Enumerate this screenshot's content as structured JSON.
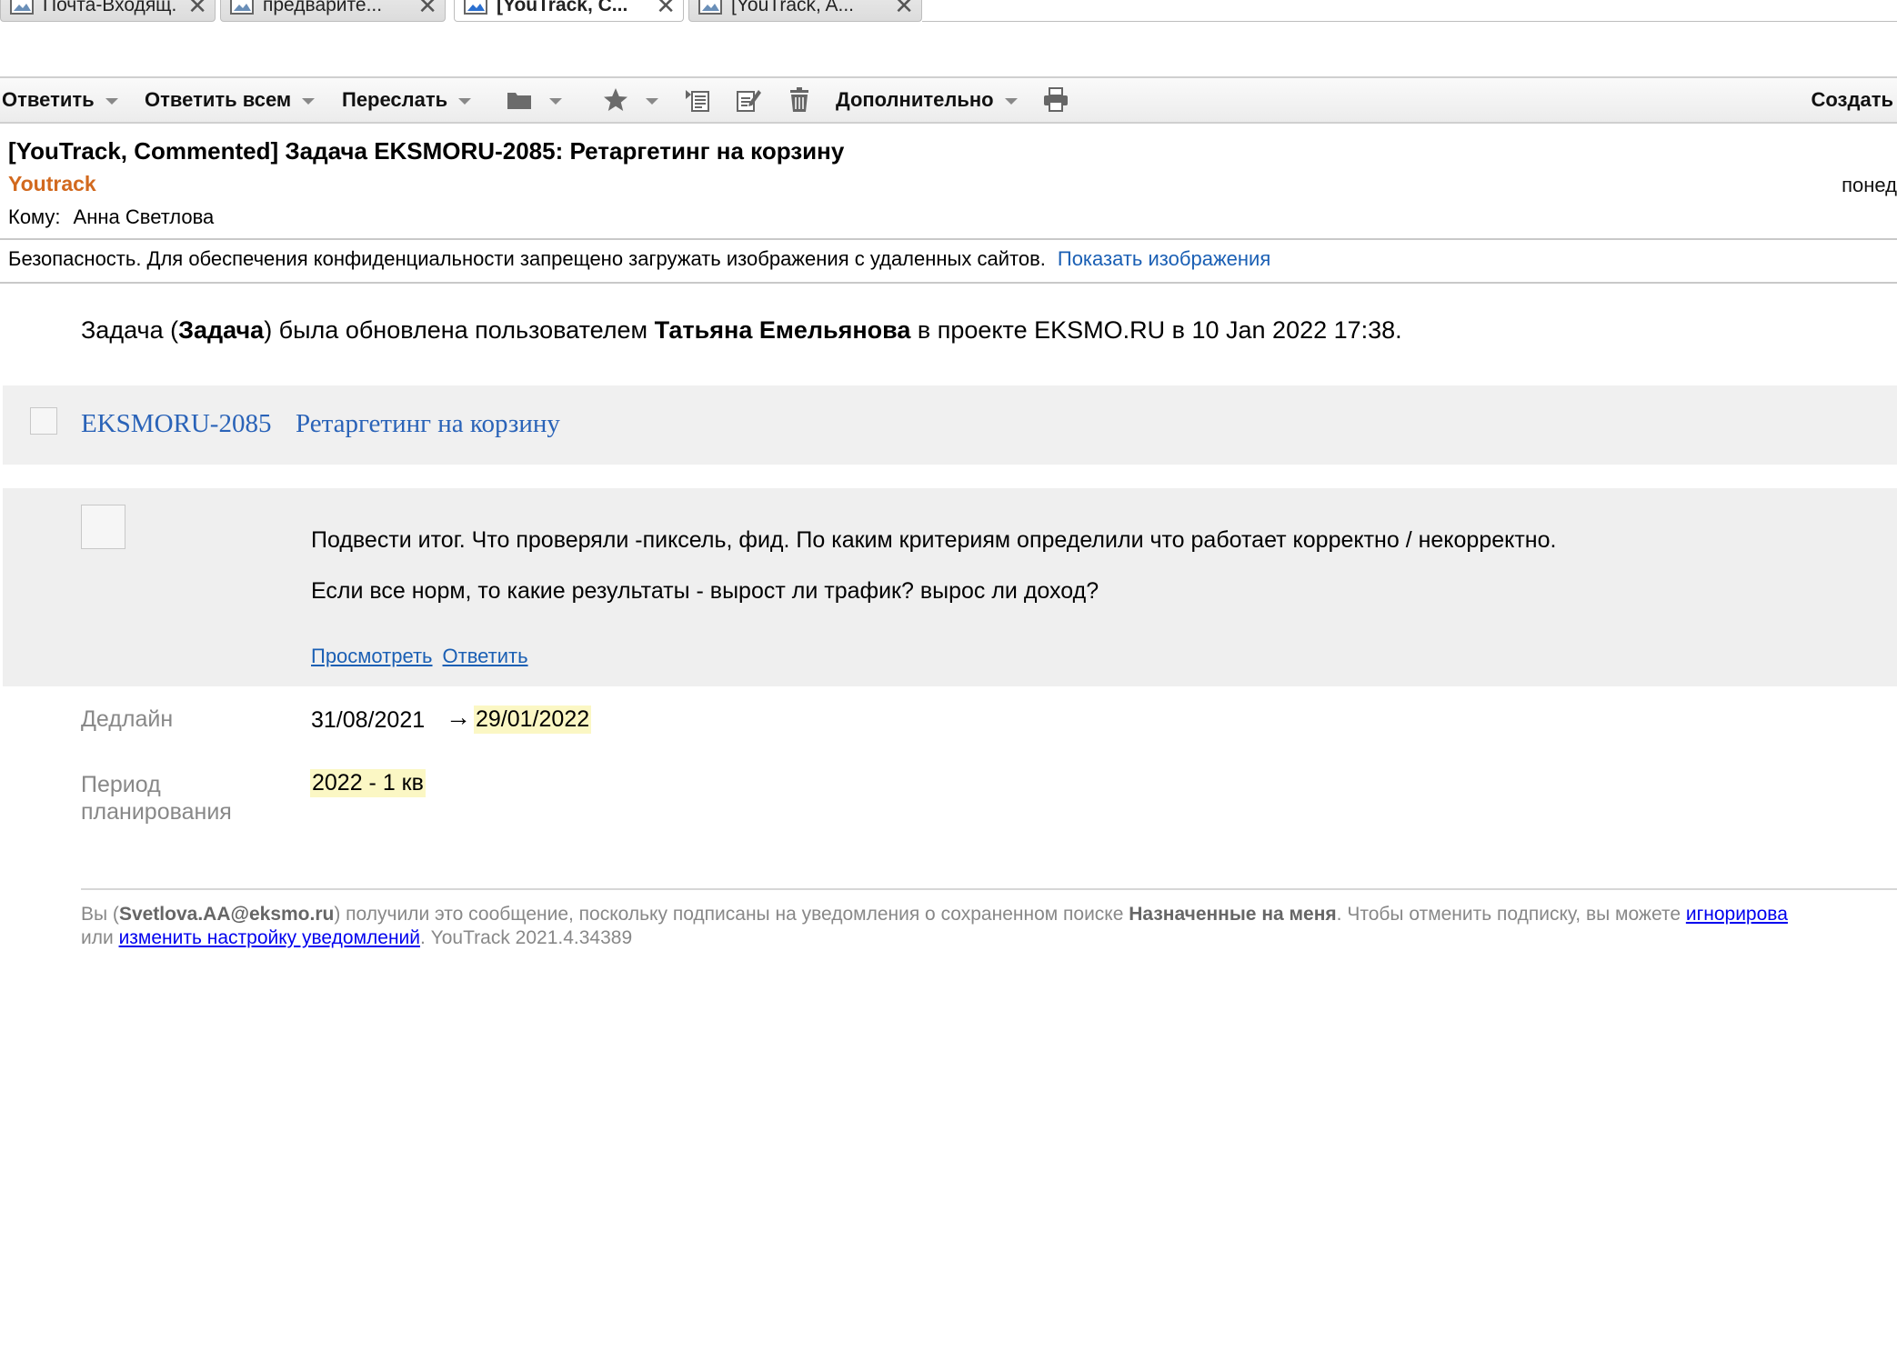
{
  "tabs": [
    {
      "label": "Почта-Входящ..."
    },
    {
      "label": "предварите..."
    },
    {
      "label": "[YouTrack, C...",
      "active": true
    },
    {
      "label": "[YouTrack, A..."
    }
  ],
  "toolbar": {
    "reply": "Ответить",
    "reply_all": "Ответить всем",
    "forward": "Переслать",
    "more": "Дополнительно",
    "create": "Создать",
    "icons": [
      "folder-icon",
      "star-icon",
      "move-icon",
      "edit-icon",
      "trash-icon",
      "print-icon"
    ]
  },
  "message": {
    "subject": "[YouTrack, Commented] Задача EKSMORU-2085: Ретаргетинг на корзину",
    "sender": "Youtrack",
    "date": "понед",
    "to_label": "Кому:",
    "to": "Анна Светлова",
    "security_text": "Безопасность. Для обеспечения конфиденциальности запрещено загружать изображения с удаленных сайтов.",
    "show_images": "Показать изображения"
  },
  "body": {
    "intro": {
      "p1": "Задача (",
      "type": "Задача",
      "p2": ") была обновлена пользователем ",
      "user": "Татьяна Емельянова",
      "p3": " в проекте EKSMO.RU в 10 Jan 2022 17:38."
    },
    "issue": {
      "id": "EKSMORU-2085",
      "title": "Ретаргетинг на корзину"
    },
    "comment": {
      "line1": "Подвести итог. Что проверяли -пиксель, фид. По каким критериям определили что работает корректно / некорректно.",
      "line2": "Если все норм, то какие результаты - вырост ли трафик? вырос ли доход?",
      "view_link": "Просмотреть",
      "reply_link": "Ответить"
    },
    "fields": {
      "deadline_label": "Дедлайн",
      "deadline_old": "31/08/2021",
      "deadline_arrow": "→",
      "deadline_new": "29/01/2022",
      "period_label": "Период планирования",
      "period_value": "2022 - 1 кв"
    },
    "footer": {
      "t1": "Вы (",
      "email": "Svetlova.AA@eksmo.ru",
      "t2": ") получили это сообщение, поскольку подписаны на уведомления о сохраненном поиске ",
      "search": "Назначенные на меня",
      "t3": ". Чтобы отменить подписку, вы можете ",
      "ignore_link": "игнорирова",
      "t4": "или ",
      "settings_link": "изменить настройку уведомлений",
      "t5": ". YouTrack 2021.4.34389"
    }
  },
  "colors": {
    "sender": "#d2691e",
    "link": "#1a5fb4",
    "highlight": "#fbf7c4",
    "panel": "#f0f0f0"
  }
}
